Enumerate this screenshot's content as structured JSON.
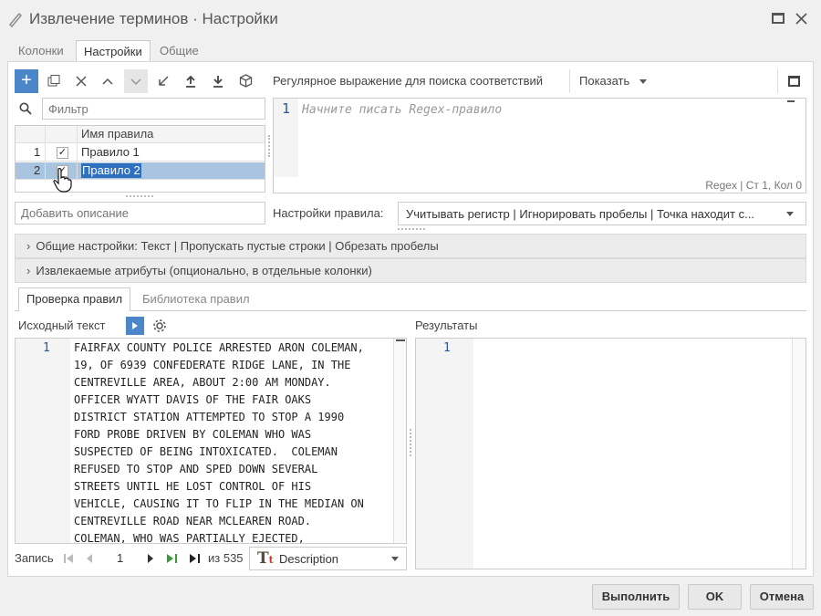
{
  "window": {
    "title": "Извлечение терминов · Настройки",
    "controls": [
      "maximize",
      "close"
    ]
  },
  "tabs_top": [
    {
      "label": "Колонки"
    },
    {
      "label": "Настройки"
    },
    {
      "label": "Общие"
    }
  ],
  "toolbar": {
    "add": "+",
    "regex_label": "Регулярное выражение для поиска соответствий",
    "show_label": "Показать"
  },
  "filter": {
    "placeholder": "Фильтр"
  },
  "rules_grid": {
    "header": "Имя правила",
    "rows": [
      {
        "num": "1",
        "name": "Правило 1",
        "checked": true
      },
      {
        "num": "2",
        "name": "Правило 2",
        "checked": true
      }
    ]
  },
  "editor": {
    "line_number": "1",
    "placeholder": "Начните писать Regex-правило",
    "status": "Regex | Ст 1, Кол 0"
  },
  "description": {
    "placeholder": "Добавить описание"
  },
  "rule_settings": {
    "label": "Настройки правила:",
    "value": "Учитывать регистр | Игнорировать пробелы | Точка находит с..."
  },
  "sections": [
    {
      "label": "Общие настройки: Текст | Пропускать пустые строки | Обрезать пробелы"
    },
    {
      "label": "Извлекаемые атрибуты (опционально, в отдельные колонки)"
    }
  ],
  "tabs_bottom": [
    {
      "label": "Проверка правил"
    },
    {
      "label": "Библиотека правил"
    }
  ],
  "source": {
    "label": "Исходный текст",
    "line_number": "1",
    "lines": [
      "FAIRFAX COUNTY POLICE ARRESTED ARON COLEMAN,",
      "19, OF 6939 CONFEDERATE RIDGE LANE, IN THE",
      "CENTREVILLE AREA, ABOUT 2:00 AM MONDAY.",
      "OFFICER WYATT DAVIS OF THE FAIR OAKS",
      "DISTRICT STATION ATTEMPTED TO STOP A 1990",
      "FORD PROBE DRIVEN BY COLEMAN WHO WAS",
      "SUSPECTED OF BEING INTOXICATED.  COLEMAN",
      "REFUSED TO STOP AND SPED DOWN SEVERAL",
      "STREETS UNTIL HE LOST CONTROL OF HIS",
      "VEHICLE, CAUSING IT TO FLIP IN THE MEDIAN ON",
      "CENTREVILLE ROAD NEAR MCLEAREN ROAD.",
      "COLEMAN, WHO WAS PARTIALLY EJECTED,"
    ]
  },
  "results": {
    "label": "Результаты",
    "line_number": "1"
  },
  "record_nav": {
    "label": "Запись",
    "current": "1",
    "of_label": "из 535",
    "field": "Description"
  },
  "buttons": {
    "run": "Выполнить",
    "ok": "OK",
    "cancel": "Отмена"
  },
  "colors": {
    "accent": "#4a86c8",
    "selected_row": "#a9c4e0",
    "selection_text": "#2f6fc0"
  }
}
